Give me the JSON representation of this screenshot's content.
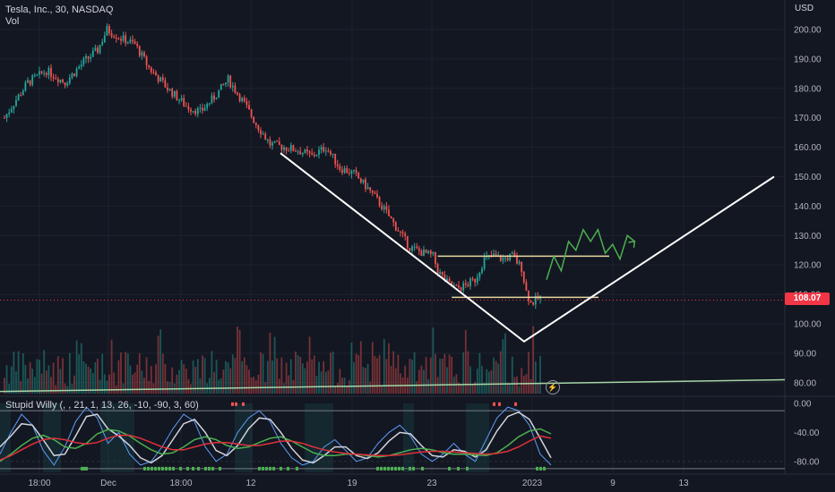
{
  "legend": {
    "symbol_line": "Tesla, Inc., 30, NASDAQ",
    "vol_label": "Vol"
  },
  "indicator": {
    "label": "Stupid Willy (, , 21, 1, 13, 26, -10, -90, 3, 60)"
  },
  "currency": "USD",
  "last_price": "108.07",
  "colors": {
    "background": "#131722",
    "up": "#26a69a",
    "down": "#ef5350",
    "price_badge": "#f23645",
    "drawing": "#ffffff",
    "projection": "#4caf50",
    "level_line": "#e8d6a0"
  },
  "chart_data": [
    {
      "type": "candlestick",
      "title": "Tesla, Inc., 30, NASDAQ",
      "x_tick_labels": [
        "18:00",
        "Dec",
        "18:00",
        "12",
        "19",
        "23",
        "2023",
        "9",
        "13"
      ],
      "y_tick_labels": [
        "200.00",
        "190.00",
        "180.00",
        "170.00",
        "160.00",
        "150.00",
        "140.00",
        "130.00",
        "120.00",
        "110.00",
        "100.00",
        "90.00",
        "80.00"
      ],
      "ylim": [
        76,
        203
      ],
      "currency": "USD",
      "last_price": 108.07,
      "price_path_key_points": [
        [
          0,
          170
        ],
        [
          4,
          175
        ],
        [
          10,
          182
        ],
        [
          18,
          186
        ],
        [
          26,
          182
        ],
        [
          34,
          189
        ],
        [
          40,
          193
        ],
        [
          44,
          200
        ],
        [
          50,
          197
        ],
        [
          56,
          195
        ],
        [
          62,
          187
        ],
        [
          70,
          180
        ],
        [
          78,
          174
        ],
        [
          84,
          172
        ],
        [
          90,
          177
        ],
        [
          96,
          183
        ],
        [
          102,
          176
        ],
        [
          108,
          168
        ],
        [
          114,
          161
        ],
        [
          120,
          160
        ],
        [
          126,
          159
        ],
        [
          132,
          157
        ],
        [
          138,
          160
        ],
        [
          144,
          153
        ],
        [
          150,
          151
        ],
        [
          156,
          146
        ],
        [
          162,
          140
        ],
        [
          168,
          133
        ],
        [
          174,
          126
        ],
        [
          180,
          124
        ],
        [
          184,
          123
        ],
        [
          186,
          118
        ],
        [
          190,
          114
        ],
        [
          194,
          112
        ],
        [
          198,
          113
        ],
        [
          202,
          115
        ],
        [
          206,
          122
        ],
        [
          210,
          123
        ],
        [
          214,
          122
        ],
        [
          218,
          123
        ],
        [
          222,
          119
        ],
        [
          224,
          111
        ],
        [
          226,
          107
        ],
        [
          230,
          109
        ]
      ],
      "levels": [
        123,
        109
      ],
      "trendline_v": [
        [
          157,
          158
        ],
        [
          232,
          94
        ],
        [
          344,
          150
        ]
      ],
      "projection_path": [
        115,
        123,
        118,
        128,
        125,
        132,
        128,
        132,
        124,
        127,
        122,
        130,
        128
      ],
      "volume": {
        "label": "Vol",
        "ma_line": [
          77,
          79,
          81
        ]
      }
    },
    {
      "type": "line",
      "title": "Stupid Willy (, , 21, 1, 13, 26, -10, -90, 3, 60)",
      "y_tick_labels": [
        "0.00",
        "-40.00",
        "-80.00"
      ],
      "ylim": [
        -100,
        0
      ],
      "levels": [
        -10,
        -90
      ],
      "series": [
        {
          "color": "#5b9cf6",
          "values": [
            -70,
            -40,
            -15,
            -30,
            -65,
            -85,
            -60,
            -25,
            -5,
            -20,
            -55,
            -40,
            -70,
            -85,
            -80,
            -60,
            -35,
            -15,
            -25,
            -60,
            -80,
            -70,
            -40,
            -20,
            -10,
            -25,
            -55,
            -75,
            -85,
            -80,
            -60,
            -50,
            -65,
            -80,
            -75,
            -55,
            -40,
            -30,
            -45,
            -70,
            -80,
            -70,
            -55,
            -70,
            -80,
            -50,
            -20,
            -5,
            -10,
            -30,
            -70,
            -85
          ]
        },
        {
          "color": "#d1d4dc",
          "values": [
            -60,
            -45,
            -28,
            -30,
            -50,
            -72,
            -70,
            -45,
            -18,
            -15,
            -35,
            -45,
            -58,
            -75,
            -82,
            -72,
            -50,
            -28,
            -22,
            -40,
            -65,
            -72,
            -58,
            -35,
            -20,
            -22,
            -40,
            -62,
            -78,
            -82,
            -72,
            -60,
            -60,
            -72,
            -76,
            -68,
            -52,
            -40,
            -42,
            -58,
            -72,
            -74,
            -64,
            -66,
            -74,
            -64,
            -38,
            -18,
            -12,
            -22,
            -48,
            -75
          ]
        },
        {
          "color": "#4caf50",
          "values": [
            -80,
            -70,
            -58,
            -48,
            -44,
            -50,
            -60,
            -62,
            -55,
            -42,
            -36,
            -38,
            -45,
            -55,
            -64,
            -70,
            -68,
            -60,
            -50,
            -46,
            -50,
            -58,
            -62,
            -60,
            -54,
            -48,
            -46,
            -52,
            -60,
            -68,
            -72,
            -72,
            -70,
            -70,
            -72,
            -74,
            -72,
            -68,
            -64,
            -62,
            -64,
            -68,
            -70,
            -70,
            -71,
            -72,
            -68,
            -58,
            -46,
            -38,
            -35,
            -42
          ]
        },
        {
          "color": "#e0303a",
          "values": [
            -78,
            -72,
            -64,
            -56,
            -50,
            -48,
            -50,
            -54,
            -56,
            -54,
            -48,
            -44,
            -44,
            -48,
            -54,
            -60,
            -64,
            -64,
            -60,
            -56,
            -54,
            -54,
            -56,
            -58,
            -58,
            -55,
            -52,
            -52,
            -55,
            -60,
            -64,
            -67,
            -69,
            -70,
            -71,
            -72,
            -72,
            -71,
            -69,
            -67,
            -66,
            -66,
            -67,
            -68,
            -69,
            -70,
            -69,
            -66,
            -60,
            -52,
            -45,
            -48
          ]
        }
      ]
    }
  ]
}
